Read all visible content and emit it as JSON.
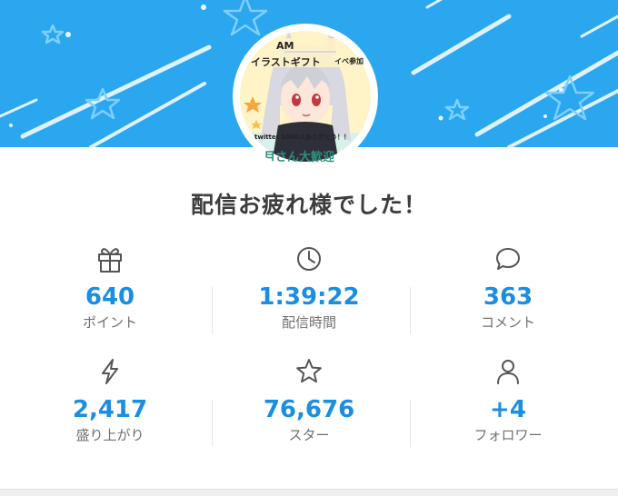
{
  "banner": {
    "avatar_caption_lines": [
      "AM",
      "イラストギフト",
      "イベ参加",
      "twitter 1000人ありがとう！！",
      "月さん大歓迎"
    ]
  },
  "headline": "配信お疲れ様でした！",
  "stats": [
    {
      "icon": "gift-icon",
      "value": "640",
      "label": "ポイント"
    },
    {
      "icon": "clock-icon",
      "value": "1:39:22",
      "label": "配信時間"
    },
    {
      "icon": "comment-icon",
      "value": "363",
      "label": "コメント"
    },
    {
      "icon": "lightning-icon",
      "value": "2,417",
      "label": "盛り上がり"
    },
    {
      "icon": "star-icon",
      "value": "76,676",
      "label": "スター"
    },
    {
      "icon": "person-icon",
      "value": "+4",
      "label": "フォロワー"
    }
  ],
  "colors": {
    "banner": "#2aa7ee",
    "value": "#1a8ee0",
    "label": "#707070",
    "headline": "#3d3d3d",
    "icon": "#555555"
  }
}
